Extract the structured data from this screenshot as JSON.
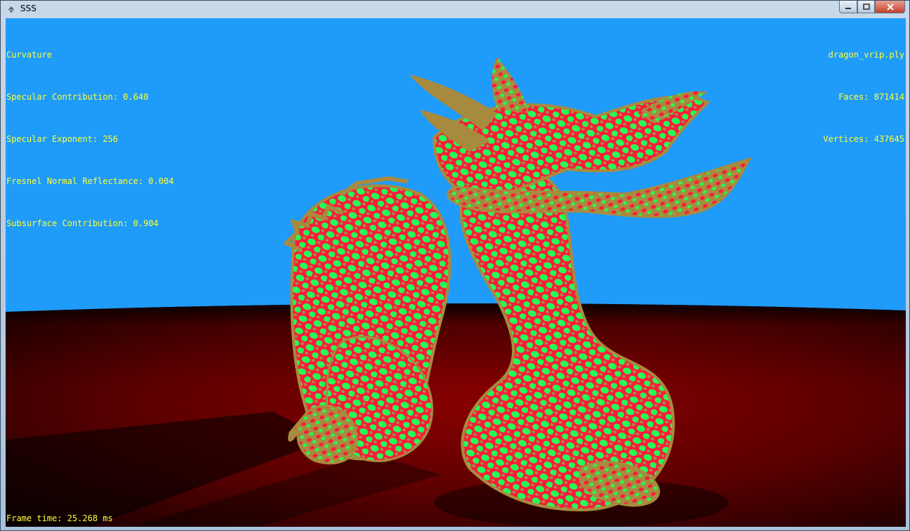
{
  "window": {
    "title": "SSS",
    "icons": {
      "app": "app-icon",
      "minimize": "minimize-icon",
      "maximize": "maximize-icon",
      "close": "close-icon"
    },
    "controls": {
      "minimize": "▁",
      "maximize": "□",
      "close": "✕"
    }
  },
  "hud": {
    "left": [
      "Curvature",
      "Specular Contribution: 0.640",
      "Specular Exponent: 256",
      "Fresnel Normal Reflectance: 0.004",
      "Subsurface Contribution: 0.904"
    ],
    "right": [
      "dragon_vrip.ply",
      "Faces: 871414",
      "Vertices: 437645"
    ],
    "frame_time": "Frame time: 25.268 ms"
  },
  "colors": {
    "sky": "#1f9bfa",
    "ground": "#7a0000",
    "hud_text": "#ffff33",
    "dragon_base": "#a88a3e",
    "dragon_red": "#ff1a3c",
    "dragon_green": "#22ff55"
  }
}
